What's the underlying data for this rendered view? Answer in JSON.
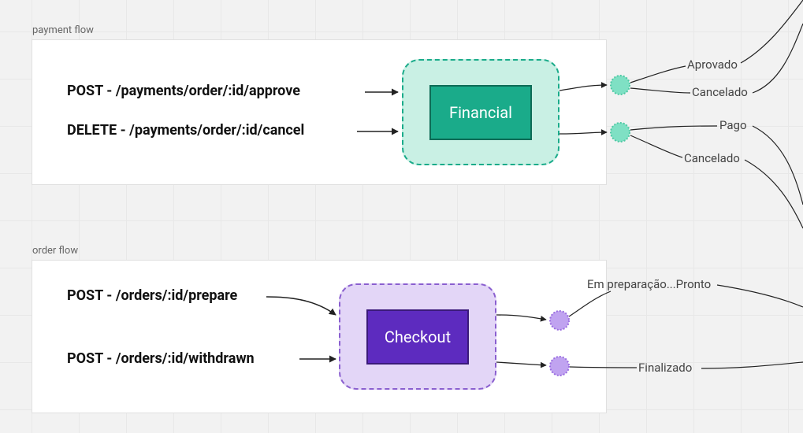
{
  "groups": {
    "payment": {
      "label": "payment flow"
    },
    "order": {
      "label": "order flow"
    }
  },
  "endpoints": {
    "approve": "POST - /payments/order/:id/approve",
    "cancelPay": "DELETE - /payments/order/:id/cancel",
    "prepare": "POST - /orders/:id/prepare",
    "withdrawn": "POST - /orders/:id/withdrawn"
  },
  "services": {
    "financial": "Financial",
    "checkout": "Checkout"
  },
  "events": {
    "aprovado": "Aprovado",
    "cancelado1": "Cancelado",
    "pago": "Pago",
    "cancelado2": "Cancelado",
    "preparacao": "Em preparação...Pronto",
    "finalizado": "Finalizado"
  },
  "colors": {
    "financial_bg": "#c9f0e4",
    "financial_border": "#1aab8a",
    "financial_fill": "#1aab8a",
    "checkout_bg": "#e3d6f7",
    "checkout_border": "#8a5fcf",
    "checkout_fill": "#5d2bbf",
    "gear_green": "#7fe0c4",
    "gear_purple": "#c0a3f0"
  }
}
